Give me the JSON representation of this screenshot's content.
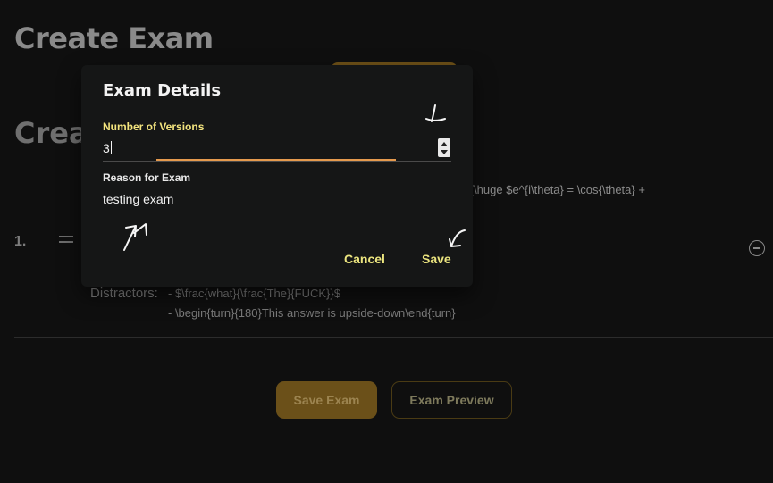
{
  "page": {
    "title": "Create Exam",
    "section_title_partial": "Crea"
  },
  "question": {
    "number": "1.",
    "text_partial": "ox{\\huge $e^{i\\theta} = \\cos{\\theta} +",
    "distractors_label": "Distractors:",
    "distractors": [
      "- $\\frac{what}{\\frac{The}{FUCK}}$",
      "- \\begin{turn}{180}This answer is upside-down\\end{turn}"
    ]
  },
  "footer": {
    "save_exam_label": "Save Exam",
    "preview_label": "Exam Preview"
  },
  "dialog": {
    "title": "Exam Details",
    "versions_label": "Number of Versions",
    "versions_value": "3",
    "reason_label": "Reason for Exam",
    "reason_value": "testing exam",
    "cancel_label": "Cancel",
    "save_label": "Save"
  },
  "colors": {
    "accent_yellow": "#f4e57e",
    "focus_orange": "#e59a4e",
    "dialog_bg": "#151616"
  }
}
